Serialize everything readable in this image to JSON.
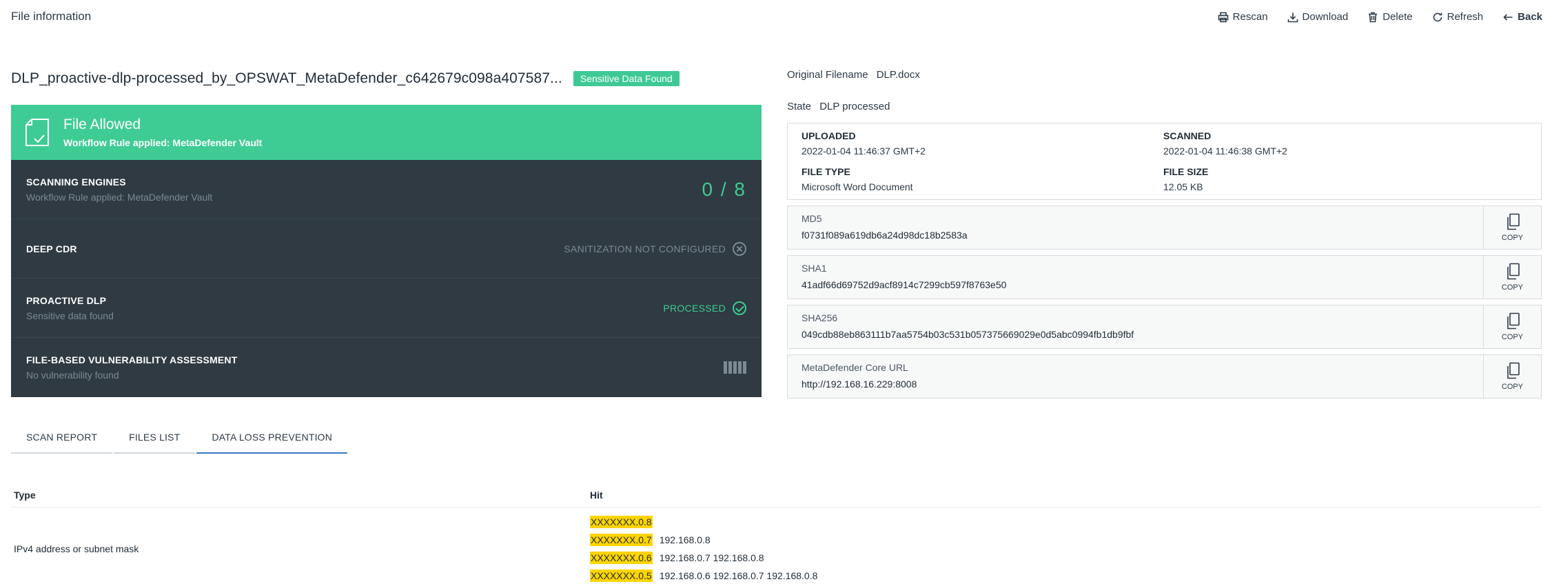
{
  "header": {
    "title": "File information"
  },
  "actions": {
    "rescan": "Rescan",
    "download": "Download",
    "delete": "Delete",
    "refresh": "Refresh",
    "back": "Back"
  },
  "file": {
    "name": "DLP_proactive-dlp-processed_by_OPSWAT_MetaDefender_c642679c098a407587...",
    "badge": "Sensitive Data Found"
  },
  "verdict": {
    "title": "File Allowed",
    "subtitle": "Workflow Rule applied: MetaDefender Vault"
  },
  "engines": [
    {
      "name": "SCANNING ENGINES",
      "desc": "Workflow Rule applied: MetaDefender Vault",
      "status": "0 / 8"
    },
    {
      "name": "DEEP CDR",
      "desc": "",
      "status": "SANITIZATION NOT CONFIGURED"
    },
    {
      "name": "PROACTIVE DLP",
      "desc": "Sensitive data found",
      "status": "PROCESSED"
    },
    {
      "name": "FILE-BASED VULNERABILITY ASSESSMENT",
      "desc": "No vulnerability found",
      "status": ""
    }
  ],
  "tabs": [
    {
      "label": "SCAN REPORT"
    },
    {
      "label": "FILES LIST"
    },
    {
      "label": "DATA LOSS PREVENTION"
    }
  ],
  "dlp": {
    "headers": {
      "type": "Type",
      "hit": "Hit"
    },
    "row": {
      "type": "IPv4 address or subnet mask",
      "hits": [
        {
          "masked": "XXXXXXX.0.8",
          "context": ""
        },
        {
          "masked": "XXXXXXX.0.7",
          "context": "192.168.0.8"
        },
        {
          "masked": "XXXXXXX.0.6",
          "context": "192.168.0.7 192.168.0.8"
        },
        {
          "masked": "XXXXXXX.0.5",
          "context": "192.168.0.6 192.168.0.7 192.168.0.8"
        }
      ]
    }
  },
  "meta": {
    "original_filename_label": "Original Filename",
    "original_filename": "DLP.docx",
    "state_label": "State",
    "state": "DLP processed"
  },
  "info": {
    "uploaded_label": "UPLOADED",
    "uploaded": "2022-01-04 11:46:37 GMT+2",
    "scanned_label": "SCANNED",
    "scanned": "2022-01-04 11:46:38 GMT+2",
    "filetype_label": "FILE TYPE",
    "filetype": "Microsoft Word Document",
    "filesize_label": "FILE SIZE",
    "filesize": "12.05 KB"
  },
  "hashes": [
    {
      "label": "MD5",
      "value": "f0731f089a619db6a24d98dc18b2583a",
      "copy": "COPY"
    },
    {
      "label": "SHA1",
      "value": "41adf66d69752d9acf8914c7299cb597f8763e50",
      "copy": "COPY"
    },
    {
      "label": "SHA256",
      "value": "049cdb88eb863111b7aa5754b03c531b057375669029e0d5abc0994fb1db9fbf",
      "copy": "COPY"
    },
    {
      "label": "MetaDefender Core URL",
      "value": "http://192.168.16.229:8008",
      "copy": "COPY"
    }
  ],
  "colors": {
    "accent_green": "#3ecc94",
    "dark_panel": "#2f3a42",
    "highlight": "#ffd400",
    "tab_active": "#3b78c9"
  }
}
